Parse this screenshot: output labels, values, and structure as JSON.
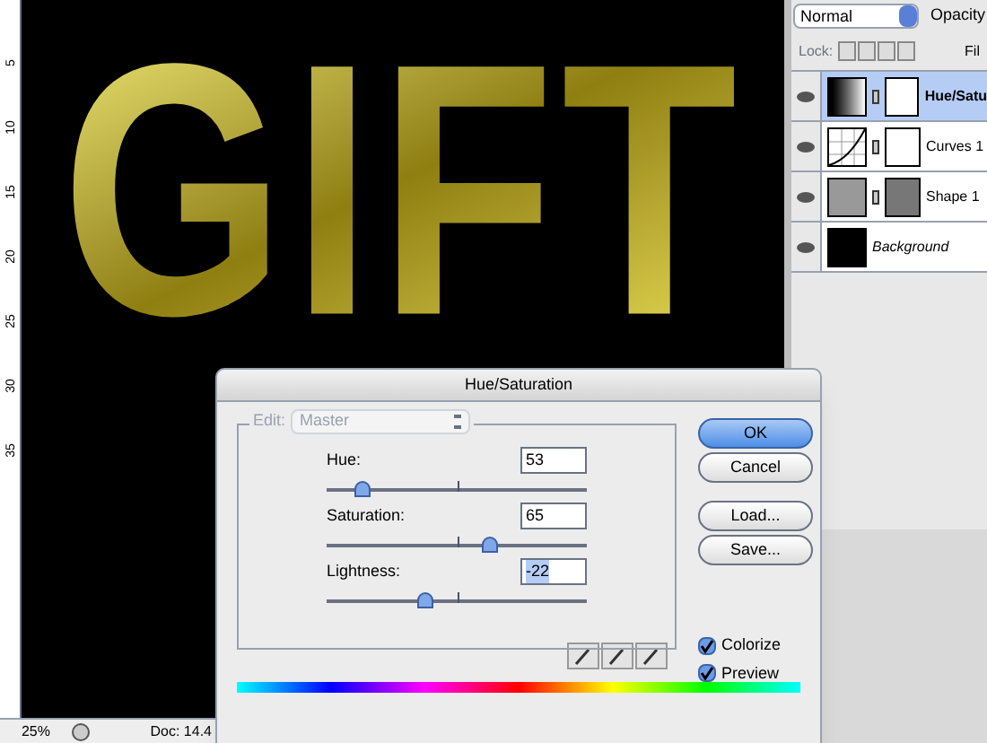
{
  "canvas": {
    "artwork_text": "GIFT",
    "ruler_labels": [
      "5",
      "10",
      "15",
      "20",
      "25",
      "30",
      "35"
    ]
  },
  "status_bar": {
    "zoom": "25%",
    "doc": "Doc: 14.4"
  },
  "layers_panel": {
    "blend_mode": "Normal",
    "opacity_label": "Opacity",
    "lock_label": "Lock:",
    "fill_label": "Fil",
    "layers": [
      {
        "name": "Hue/Satu",
        "kind": "hue-saturation",
        "selected": true,
        "visible": true
      },
      {
        "name": "Curves 1",
        "kind": "curves",
        "selected": false,
        "visible": true
      },
      {
        "name": "Shape 1",
        "kind": "shape",
        "selected": false,
        "visible": true
      },
      {
        "name": "Background",
        "kind": "background",
        "selected": false,
        "visible": true
      }
    ]
  },
  "dialog": {
    "title": "Hue/Saturation",
    "edit_label": "Edit:",
    "edit_value": "Master",
    "edit_disabled": true,
    "sliders": [
      {
        "label": "Hue:",
        "value": "53",
        "level": 0.14,
        "highlighted": false
      },
      {
        "label": "Saturation:",
        "value": "65",
        "level": 0.63,
        "highlighted": false
      },
      {
        "label": "Lightness:",
        "value": "-22",
        "level": 0.38,
        "highlighted": true
      }
    ],
    "buttons": [
      {
        "label": "OK",
        "default": true
      },
      {
        "label": "Cancel",
        "default": false
      },
      {
        "label": "Load...",
        "default": false
      },
      {
        "label": "Save...",
        "default": false
      }
    ],
    "checkboxes": [
      {
        "label": "Colorize",
        "checked": true
      },
      {
        "label": "Preview",
        "checked": true
      }
    ]
  }
}
